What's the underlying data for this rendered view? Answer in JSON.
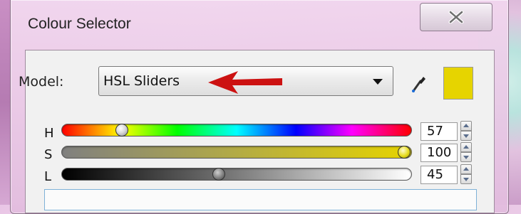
{
  "window": {
    "title": "Colour Selector"
  },
  "model": {
    "label": "Model:",
    "value": "HSL Sliders"
  },
  "icons": {
    "close": "close-icon",
    "eyedropper": "eyedropper-icon",
    "dropdown": "chevron-down-icon",
    "annotation": "red-arrow-icon"
  },
  "swatch_color": "#e6d400",
  "sliders": [
    {
      "label": "H",
      "value": "57",
      "fraction": 0.16,
      "track": "hue",
      "thumb": "yellow"
    },
    {
      "label": "S",
      "value": "100",
      "fraction": 1.0,
      "track": "saturation",
      "thumb": "yellow"
    },
    {
      "label": "L",
      "value": "45",
      "fraction": 0.45,
      "track": "lightness",
      "thumb": "gray"
    }
  ],
  "colors": {
    "accent_red": "#cc1111",
    "swatch": "#e6d400"
  }
}
